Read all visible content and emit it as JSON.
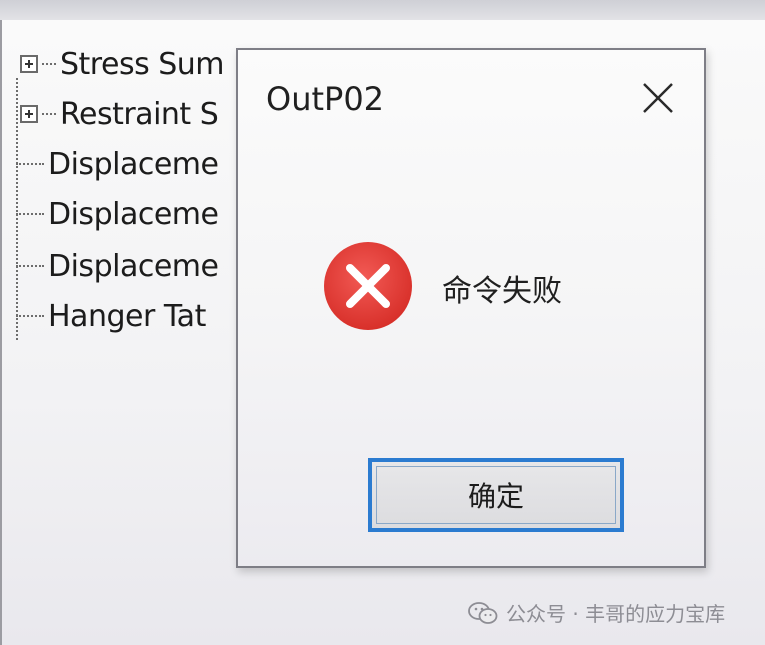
{
  "tree": {
    "items": [
      {
        "label": "Stress Sum",
        "expandable": true
      },
      {
        "label": "Restraint S",
        "expandable": true
      },
      {
        "label": "Displaceme",
        "expandable": false
      },
      {
        "label": "Displaceme",
        "expandable": false
      },
      {
        "label": "Displaceme",
        "expandable": false
      },
      {
        "label": "Hanger Tat",
        "expandable": false
      }
    ]
  },
  "dialog": {
    "title": "OutP02",
    "message": "命令失败",
    "ok_label": "确定",
    "icon": "error-x-icon",
    "accent_color": "#2b7bd0",
    "error_color": "#e53935"
  },
  "watermark": {
    "text": "公众号 · 丰哥的应力宝库"
  }
}
